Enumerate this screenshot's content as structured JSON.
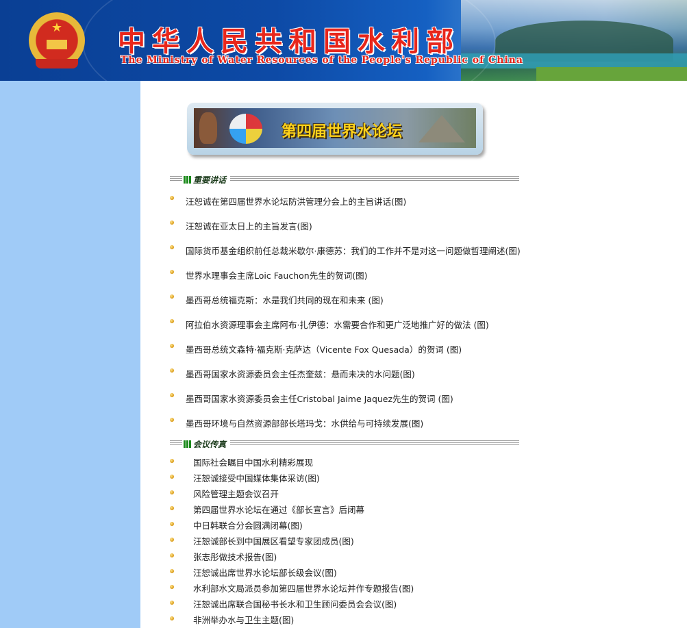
{
  "header": {
    "title_cn": "中华人民共和国水利部",
    "title_en": "The Ministry of Water Resources of the People's Republic of China",
    "emblem_icon": "national-emblem-icon"
  },
  "forum_banner": {
    "label": "第四届世界水论坛"
  },
  "sections": {
    "speeches": {
      "title": "重要讲话",
      "items": [
        "汪恕诚在第四届世界水论坛防洪管理分会上的主旨讲话(图)",
        "汪恕诚在亚太日上的主旨发言(图)",
        "国际货币基金组织前任总裁米歇尔·康德苏：我们的工作并不是对这一问题做哲理阐述(图)",
        "世界水理事会主席Loic Fauchon先生的贺词(图)",
        "墨西哥总统福克斯：水是我们共同的现在和未来 (图)",
        "阿拉伯水资源理事会主席阿布·扎伊德：水需要合作和更广泛地推广好的做法 (图)",
        "墨西哥总统文森特·福克斯·克萨达（Vicente Fox Quesada）的贺词 (图)",
        "墨西哥国家水资源委员会主任杰奎兹：悬而未决的水问题(图)",
        "墨西哥国家水资源委员会主任Cristobal Jaime Jaquez先生的贺词 (图)",
        "墨西哥环境与自然资源部部长塔玛戈：水供给与可持续发展(图)"
      ]
    },
    "news": {
      "title": "会议传真",
      "items": [
        "国际社会瞩目中国水利精彩展现",
        "汪恕诚接受中国媒体集体采访(图)",
        "风险管理主题会议召开",
        "第四届世界水论坛在通过《部长宣言》后闭幕",
        "中日韩联合分会圆满闭幕(图)",
        "汪恕诚部长到中国展区看望专家团成员(图)",
        "张志彤做技术报告(图)",
        "汪恕诚出席世界水论坛部长级会议(图)",
        "水利部水文局派员参加第四届世界水论坛并作专题报告(图)",
        "汪恕诚出席联合国秘书长水和卫生顾问委员会会议(图)",
        "非洲举办水与卫生主题(图)"
      ]
    }
  }
}
